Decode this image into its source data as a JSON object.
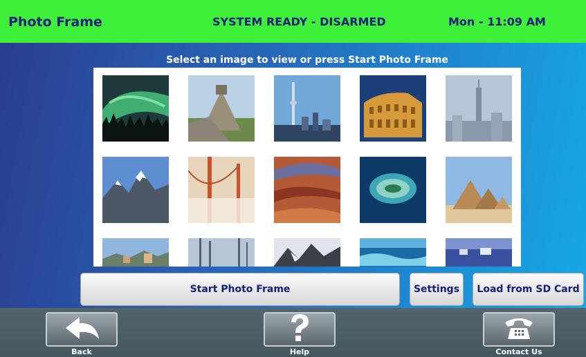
{
  "header": {
    "title": "Photo Frame",
    "status": "SYSTEM READY - DISARMED",
    "datetime": "Mon - 11:09 AM",
    "background_color": "#3ff03a",
    "text_color": "#13207a"
  },
  "instruction": "Select an image to view or press Start Photo Frame",
  "gallery": {
    "images": [
      "northern-lights-forest",
      "chichen-itza-pyramid",
      "toronto-cn-tower-skyline",
      "roman-colosseum",
      "new-york-empire-state-skyline",
      "snowy-mountain-peaks",
      "golden-gate-bridge-fog",
      "grand-canyon",
      "ocean-atoll-island",
      "giza-pyramids",
      "coastal-town",
      "harbor-masts",
      "icy-rocks",
      "ocean-waves",
      "harbor-boats"
    ]
  },
  "actions": {
    "start_label": "Start Photo Frame",
    "settings_label": "Settings",
    "sd_label": "Load from SD Card"
  },
  "nav": {
    "back_label": "Back",
    "help_label": "Help",
    "contact_label": "Contact Us",
    "back_icon": "back-arrow-icon",
    "help_icon": "question-mark-icon",
    "contact_icon": "telephone-icon"
  }
}
